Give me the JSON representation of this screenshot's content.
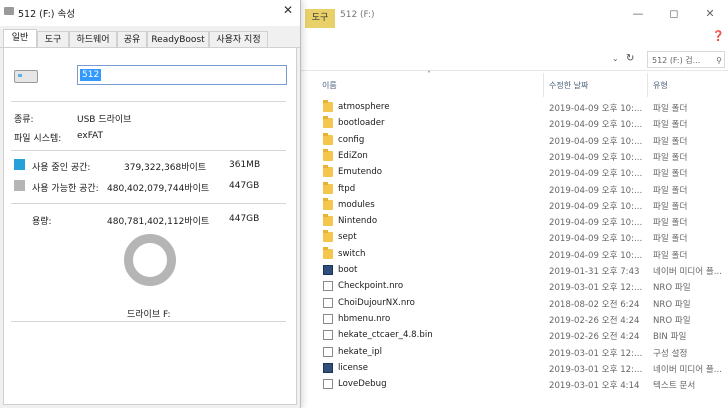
{
  "explorer": {
    "tab_label": "도구",
    "window_title": "512 (F:)",
    "search_placeholder": "512 (F:) 검...",
    "columns": {
      "name": "이름",
      "date": "수정한 날짜",
      "type": "유형"
    },
    "rows": [
      {
        "name": "atmosphere",
        "date": "2019-04-09 오후 10:...",
        "type": "파일 폴더",
        "kind": "folder"
      },
      {
        "name": "bootloader",
        "date": "2019-04-09 오후 10:...",
        "type": "파일 폴더",
        "kind": "folder"
      },
      {
        "name": "config",
        "date": "2019-04-09 오후 10:...",
        "type": "파일 폴더",
        "kind": "folder"
      },
      {
        "name": "EdiZon",
        "date": "2019-04-09 오후 10:...",
        "type": "파일 폴더",
        "kind": "folder"
      },
      {
        "name": "Emutendo",
        "date": "2019-04-09 오후 10:...",
        "type": "파일 폴더",
        "kind": "folder"
      },
      {
        "name": "ftpd",
        "date": "2019-04-09 오후 10:...",
        "type": "파일 폴더",
        "kind": "folder"
      },
      {
        "name": "modules",
        "date": "2019-04-09 오후 10:...",
        "type": "파일 폴더",
        "kind": "folder"
      },
      {
        "name": "Nintendo",
        "date": "2019-04-09 오후 10:...",
        "type": "파일 폴더",
        "kind": "folder"
      },
      {
        "name": "sept",
        "date": "2019-04-09 오후 10:...",
        "type": "파일 폴더",
        "kind": "folder"
      },
      {
        "name": "switch",
        "date": "2019-04-09 오후 10:...",
        "type": "파일 폴더",
        "kind": "folder"
      },
      {
        "name": "boot",
        "date": "2019-01-31 오후 7:43",
        "type": "네이버 미디어 플...",
        "kind": "bin"
      },
      {
        "name": "Checkpoint.nro",
        "date": "2019-03-01 오후 12:...",
        "type": "NRO 파일",
        "kind": "file"
      },
      {
        "name": "ChoiDujourNX.nro",
        "date": "2018-08-02 오전 6:24",
        "type": "NRO 파일",
        "kind": "file"
      },
      {
        "name": "hbmenu.nro",
        "date": "2019-02-26 오전 4:24",
        "type": "NRO 파일",
        "kind": "file"
      },
      {
        "name": "hekate_ctcaer_4.8.bin",
        "date": "2019-02-26 오전 4:24",
        "type": "BIN 파일",
        "kind": "file"
      },
      {
        "name": "hekate_ipl",
        "date": "2019-03-01 오후 12:...",
        "type": "구성 설정",
        "kind": "file"
      },
      {
        "name": "license",
        "date": "2019-03-01 오후 12:...",
        "type": "네이버 미디어 플...",
        "kind": "bin"
      },
      {
        "name": "LoveDebug",
        "date": "2019-03-01 오후 4:14",
        "type": "텍스트 문서",
        "kind": "file"
      }
    ]
  },
  "dialog": {
    "title": "512 (F:) 속성",
    "tabs": [
      "일반",
      "도구",
      "하드웨어",
      "공유",
      "ReadyBoost",
      "사용자 지정"
    ],
    "volume_name": "512",
    "type_label": "종류:",
    "type_value": "USB 드라이브",
    "fs_label": "파일 시스템:",
    "fs_value": "exFAT",
    "used_label": "사용 중인 공간:",
    "used_bytes": "379,322,368바이트",
    "used_size": "361MB",
    "free_label": "사용 가능한 공간:",
    "free_bytes": "480,402,079,744바이트",
    "free_size": "447GB",
    "cap_label": "용량:",
    "cap_bytes": "480,781,402,112바이트",
    "cap_size": "447GB",
    "drive_label": "드라이브 F:",
    "colors": {
      "used": "#26a0da",
      "free": "#b5b5b5"
    },
    "used_fraction": 0.0008
  }
}
